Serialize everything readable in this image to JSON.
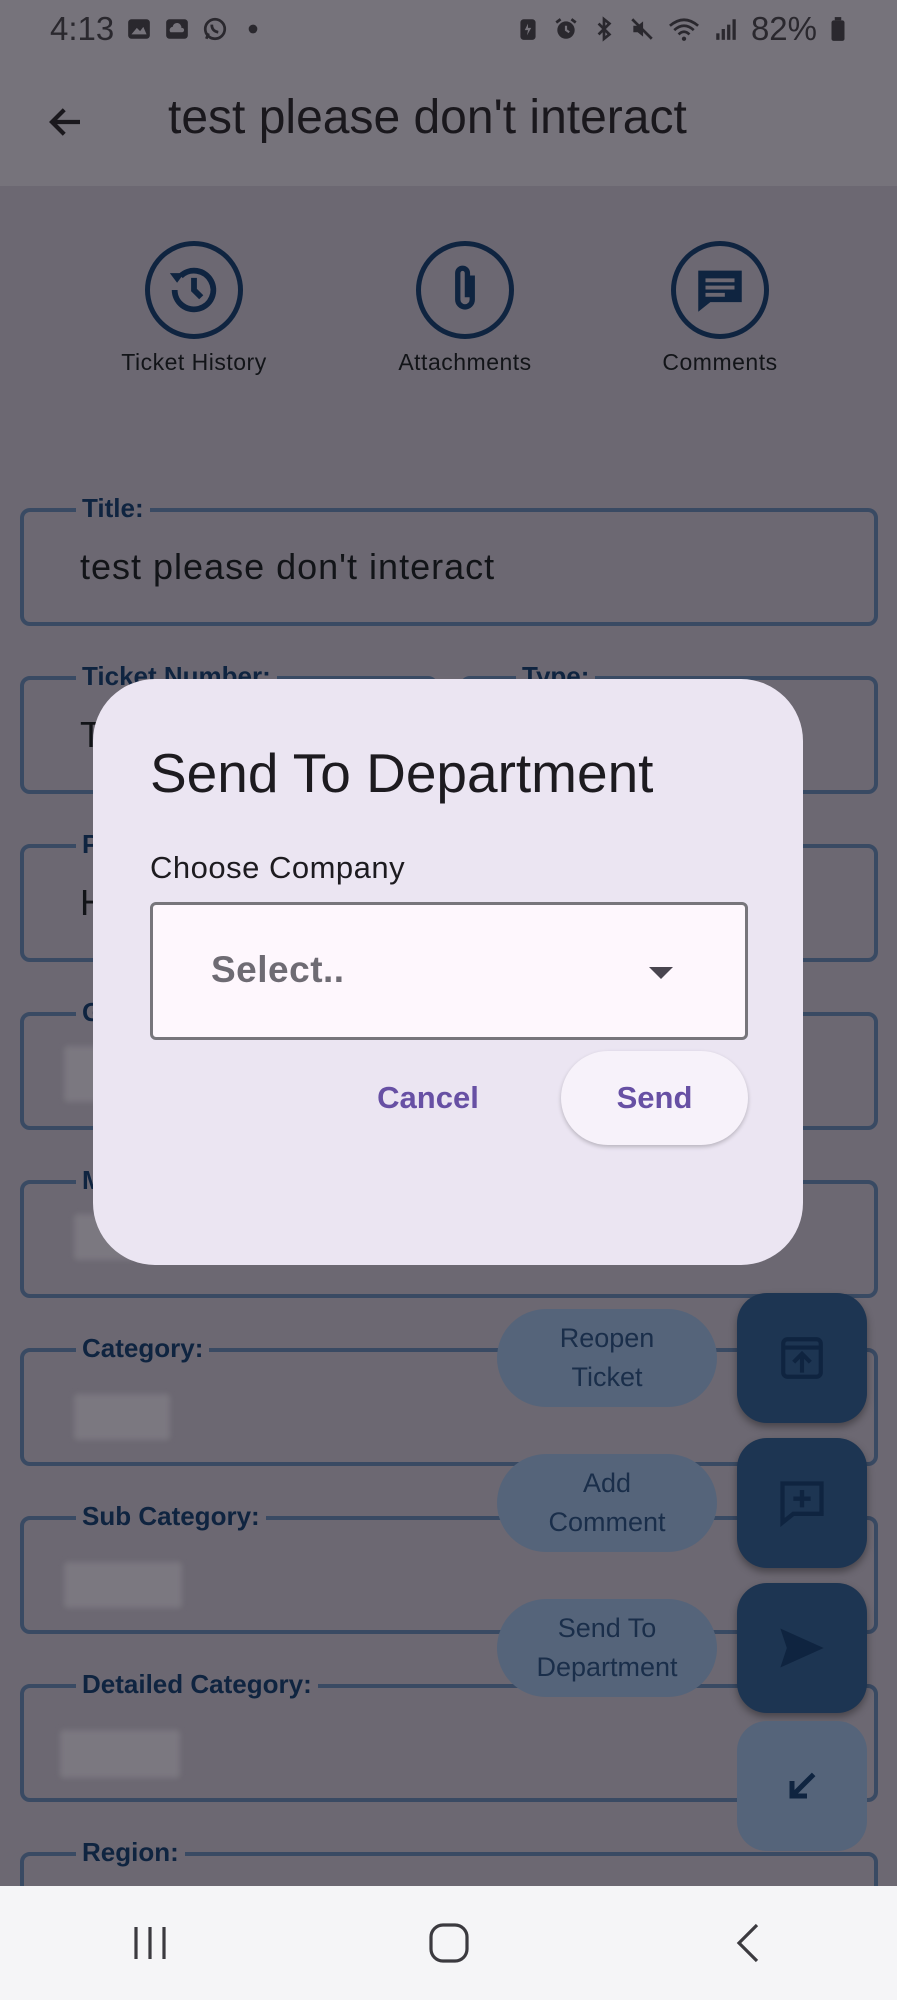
{
  "status_bar": {
    "time": "4:13",
    "battery": "82%",
    "icons": [
      "image-icon",
      "cloud-icon",
      "whatsapp-icon",
      "dot-icon",
      "battery-saver-icon",
      "alarm-icon",
      "bluetooth-icon",
      "mute-icon",
      "wifi-icon",
      "signal-icon",
      "battery-icon"
    ]
  },
  "app_bar": {
    "title": "test please don't interact",
    "back_icon": "arrow-back-icon"
  },
  "actions": [
    {
      "label": "Ticket History",
      "icon": "history-icon"
    },
    {
      "label": "Attachments",
      "icon": "paperclip-icon"
    },
    {
      "label": "Comments",
      "icon": "comment-icon"
    }
  ],
  "fields": {
    "title_label": "Title:",
    "title_value": "test please don't interact",
    "ticket_number_label": "Ticket Number:",
    "ticket_number_value_partial": "T",
    "type_label": "Type:",
    "row3_label_partial": "P",
    "row3_value_partial": "H",
    "row4_label_partial": "G",
    "row5_label_partial": "M",
    "category_label": "Category:",
    "sub_category_label": "Sub Category:",
    "detailed_category_label": "Detailed Category:",
    "region_label": "Region:"
  },
  "fab_menu": {
    "items": [
      {
        "label_line1": "Reopen",
        "label_line2": "Ticket",
        "icon": "reopen-icon"
      },
      {
        "label_line1": "Add",
        "label_line2": "Comment",
        "icon": "add-comment-icon"
      },
      {
        "label_line1": "Send To",
        "label_line2": "Department",
        "icon": "send-icon"
      }
    ],
    "close_icon": "collapse-arrow-icon"
  },
  "dialog": {
    "title": "Send To Department",
    "field_label": "Choose Company",
    "select_placeholder": "Select..",
    "cancel_label": "Cancel",
    "send_label": "Send"
  },
  "nav_bar": {
    "icons": [
      "recent-apps-icon",
      "home-icon",
      "back-icon"
    ]
  },
  "colors": {
    "dialog_bg": "#ebe5f2",
    "accent": "#6750a4",
    "fab": "#1d3552",
    "outline": "#0f2440"
  }
}
